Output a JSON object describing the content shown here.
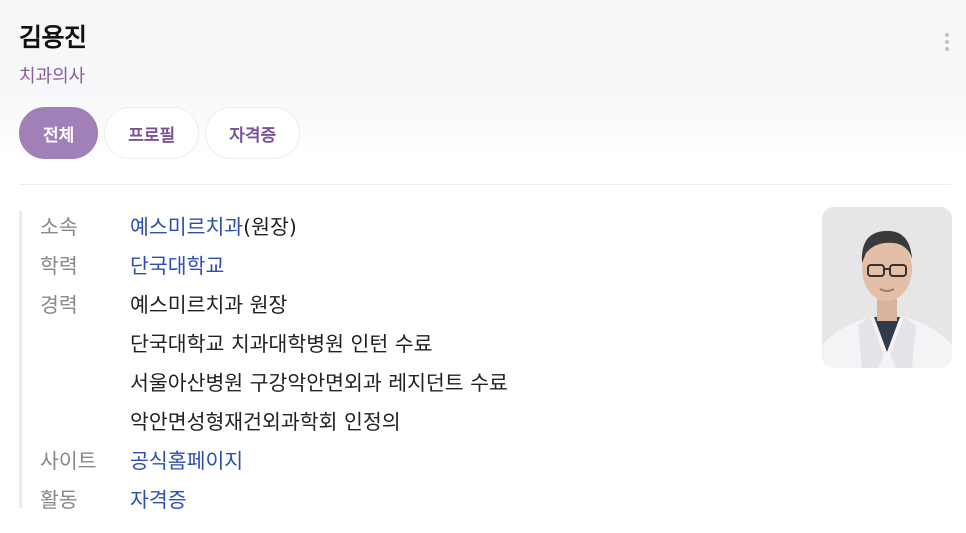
{
  "profile": {
    "name": "김용진",
    "job": "치과의사"
  },
  "tabs": [
    {
      "label": "전체",
      "active": true
    },
    {
      "label": "프로필",
      "active": false
    },
    {
      "label": "자격증",
      "active": false
    }
  ],
  "info": {
    "affiliation": {
      "label": "소속",
      "link": "예스미르치과",
      "suffix": "(원장)"
    },
    "education": {
      "label": "학력",
      "value": "단국대학교"
    },
    "career": {
      "label": "경력",
      "items": [
        "예스미르치과 원장",
        "단국대학교 치과대학병원 인턴 수료",
        "서울아산병원 구강악안면외과 레지던트 수료",
        "악안면성형재건외과학회 인정의"
      ]
    },
    "site": {
      "label": "사이트",
      "value": "공식홈페이지"
    },
    "activity": {
      "label": "활동",
      "value": "자격증"
    }
  },
  "icons": {
    "more": "more-vertical-icon",
    "photo": "profile-photo"
  },
  "colors": {
    "accent": "#a17fb7",
    "accent_text": "#7b5396",
    "job_text": "#8a5b9e",
    "link": "#2d4fb0",
    "label": "#888888"
  }
}
